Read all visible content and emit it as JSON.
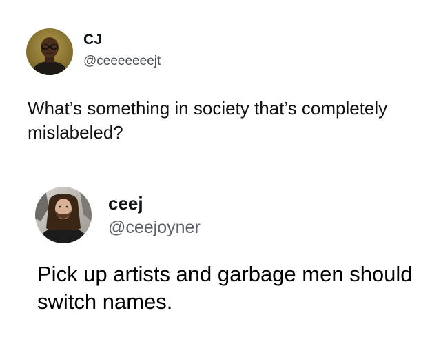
{
  "tweet_question": {
    "display_name": "CJ",
    "handle": "@ceeeeeeejt",
    "text": "What’s something in society that’s completely mislabeled?",
    "avatar_icon": "profile-photo-man-glasses"
  },
  "tweet_reply": {
    "display_name": "ceej",
    "handle": "@ceejoyner",
    "text": "Pick up artists and garbage men should switch names.",
    "avatar_icon": "profile-photo-man-long-hair"
  },
  "colors": {
    "background": "#ffffff",
    "text_primary": "#0f1419",
    "text_secondary": "#5b6168"
  }
}
